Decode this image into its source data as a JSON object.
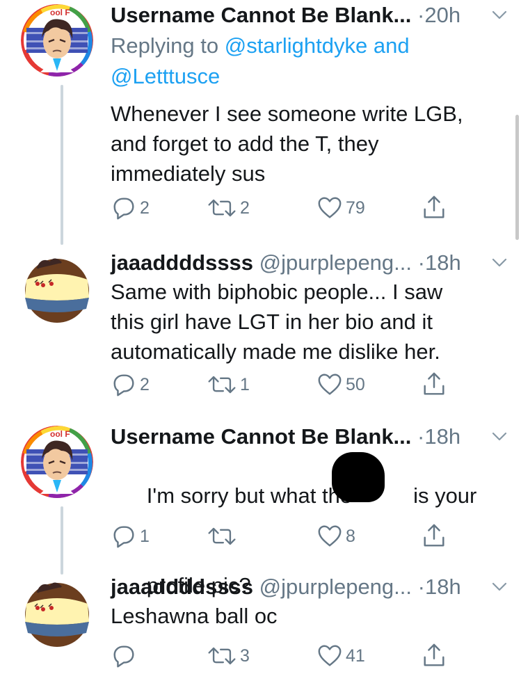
{
  "tweets": [
    {
      "name": "Username Cannot Be Blank...",
      "handle": "",
      "time": "·20h",
      "reply_prefix": "Replying to ",
      "reply_mention_1": "@starlightdyke",
      "reply_and": " and",
      "reply_mention_2": "@Letttusce",
      "text": "Whenever I see someone write LGB,\nand forget to add the T, they\nimmediately sus",
      "replies": "2",
      "retweets": "2",
      "likes": "79",
      "avatar": "rainbow-border-anime-avatar"
    },
    {
      "name": "jaaaddddssss",
      "handle": "@jpurplepeng...",
      "time": "·18h",
      "text": "Same with biphobic people... I saw\nthis girl have LGT in her bio and it\nautomatically made me dislike her.",
      "replies": "2",
      "retweets": "1",
      "likes": "50",
      "avatar": "ball-character-avatar"
    },
    {
      "name": "Username Cannot Be Blank...",
      "handle": "",
      "time": "·18h",
      "text_before": "I'm sorry but what the",
      "text_after": "is your",
      "text_line2": "profile pic?",
      "replies": "1",
      "retweets": "",
      "likes": "8",
      "avatar": "rainbow-border-anime-avatar"
    },
    {
      "name": "jaaaddddssss",
      "handle": "@jpurplepeng...",
      "time": "·18h",
      "text": "Leshawna ball oc",
      "replies": "",
      "retweets": "3",
      "likes": "41",
      "avatar": "ball-character-avatar"
    }
  ],
  "icons": {
    "reply": "reply-icon",
    "retweet": "retweet-icon",
    "like": "heart-icon",
    "share": "share-icon",
    "caret": "chevron-down-icon"
  },
  "colors": {
    "text": "#14171a",
    "secondary": "#657786",
    "link": "#1da1f2",
    "thread_line": "#ccd6dd"
  }
}
